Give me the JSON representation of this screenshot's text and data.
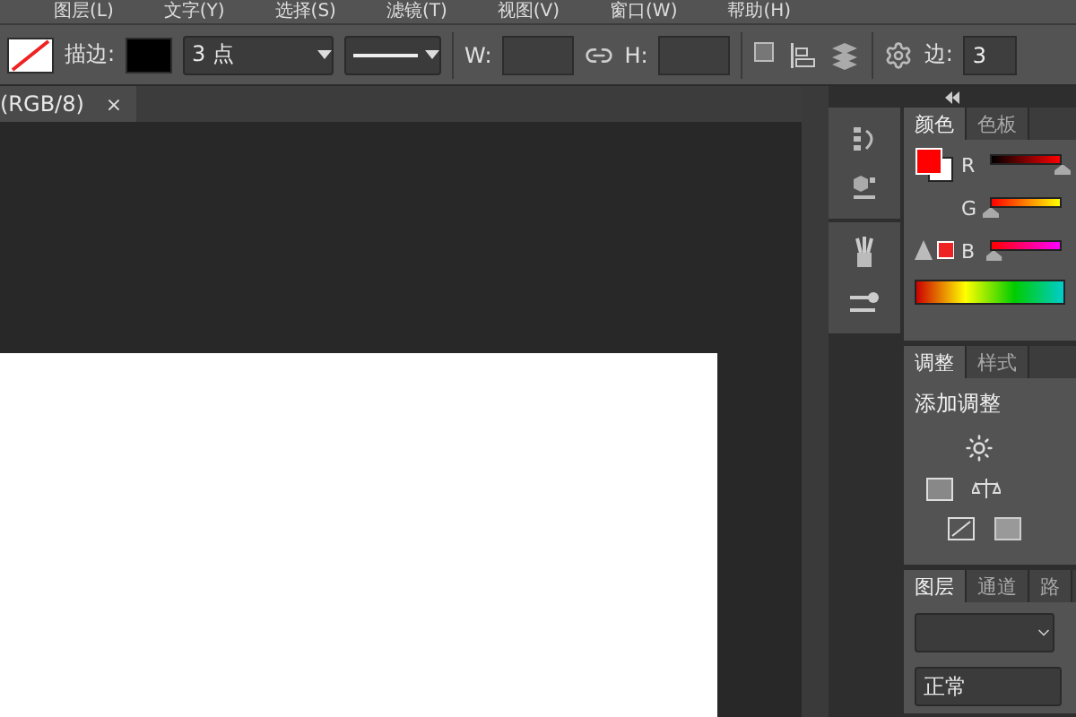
{
  "menu": [
    "图层(L)",
    "文字(Y)",
    "选择(S)",
    "滤镜(T)",
    "视图(V)",
    "窗口(W)",
    "帮助(H)"
  ],
  "options": {
    "stroke_label": "描边:",
    "stroke_width": "3 点",
    "w_label": "W:",
    "h_label": "H:",
    "edge_label": "边:",
    "edge_value": "3"
  },
  "document_tab": {
    "title": "(RGB/8)",
    "close": "×"
  },
  "color_panel": {
    "tabs": [
      {
        "label": "颜色",
        "selected": true
      },
      {
        "label": "色板",
        "selected": false
      }
    ],
    "channels": [
      {
        "name": "R",
        "level": 1
      },
      {
        "name": "G",
        "level": 0
      },
      {
        "name": "B",
        "level": 0.04
      }
    ]
  },
  "adjust_panel": {
    "tabs": [
      {
        "label": "调整",
        "selected": true
      },
      {
        "label": "样式",
        "selected": false
      }
    ],
    "title": "添加调整"
  },
  "layers_panel": {
    "tabs": [
      {
        "label": "图层",
        "selected": true
      },
      {
        "label": "通道",
        "selected": false
      },
      {
        "label": "路",
        "selected": false
      }
    ],
    "blend_mode": "正常"
  }
}
